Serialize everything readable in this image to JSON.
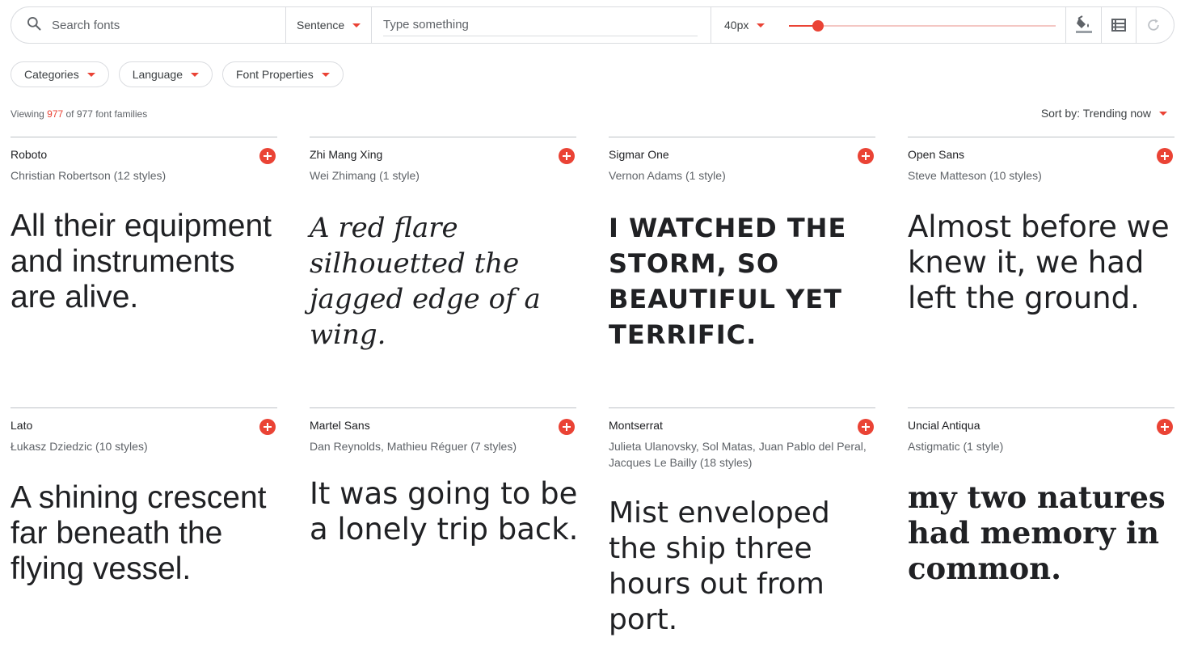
{
  "toolbar": {
    "search_placeholder": "Search fonts",
    "mode": "Sentence",
    "text_placeholder": "Type something",
    "size": "40px",
    "size_level": 0.11,
    "icons": [
      "paint-bucket-icon",
      "list-view-icon",
      "refresh-icon"
    ]
  },
  "filters": [
    "Categories",
    "Language",
    "Font Properties"
  ],
  "results": {
    "prefix": "Viewing ",
    "shown": "977",
    "suffix": " of 977 font families"
  },
  "sort": "Sort by: Trending now",
  "accent": "#ea4335",
  "fonts": [
    {
      "name": "Roboto",
      "author": "Christian Robertson (12 styles)",
      "sample": "All their equipment and instruments are alive."
    },
    {
      "name": "Zhi Mang Xing",
      "author": "Wei Zhimang (1 style)",
      "sample": "A red flare silhouetted the jagged edge of a wing."
    },
    {
      "name": "Sigmar One",
      "author": "Vernon Adams (1 style)",
      "sample": "I watched the storm, so beautiful yet terrific."
    },
    {
      "name": "Open Sans",
      "author": "Steve Matteson (10 styles)",
      "sample": "Almost before we knew it, we had left the ground."
    },
    {
      "name": "Lato",
      "author": "Łukasz Dziedzic (10 styles)",
      "sample": "A shining crescent far beneath the flying vessel."
    },
    {
      "name": "Martel Sans",
      "author": "Dan Reynolds, Mathieu Réguer (7 styles)",
      "sample": "It was going to be a lonely trip back."
    },
    {
      "name": "Montserrat",
      "author": "Julieta Ulanovsky, Sol Matas, Juan Pablo del Peral, Jacques Le Bailly (18 styles)",
      "sample": "Mist enveloped the ship three hours out from port."
    },
    {
      "name": "Uncial Antiqua",
      "author": "Astigmatic (1 style)",
      "sample": "My two natures had memory in common."
    }
  ]
}
